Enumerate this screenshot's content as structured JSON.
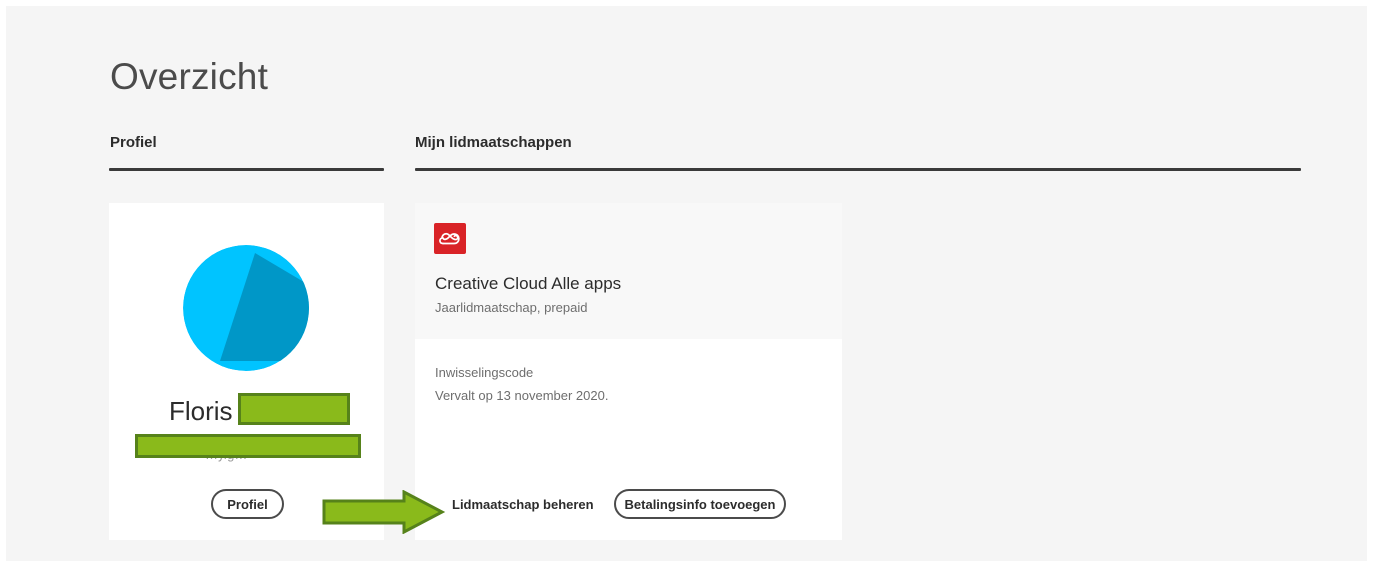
{
  "page": {
    "title": "Overzicht"
  },
  "profile_section": {
    "heading": "Profiel",
    "name": "Floris",
    "button_label": "Profiel"
  },
  "memberships_section": {
    "heading": "Mijn lidmaatschappen",
    "card": {
      "icon": "creative-cloud-icon",
      "title": "Creative Cloud Alle apps",
      "plan": "Jaarlidmaatschap, prepaid",
      "code_label": "Inwisselingscode",
      "expiry": "Vervalt op 13 november 2020.",
      "manage_label": "Lidmaatschap beheren",
      "payment_label": "Betalingsinfo toevoegen"
    }
  },
  "colors": {
    "background": "#f5f5f5",
    "card": "#ffffff",
    "avatar_light": "#00c4ff",
    "avatar_dark": "#0097c7",
    "cc_red": "#d92327",
    "annotation_green": "#8aba1b",
    "annotation_border": "#56821a"
  }
}
